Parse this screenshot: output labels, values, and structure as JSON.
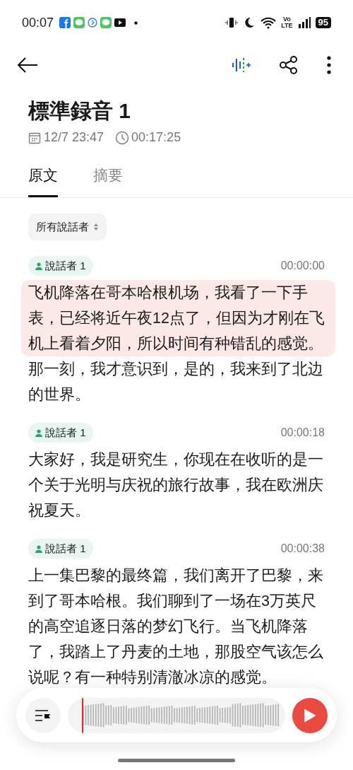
{
  "status_bar": {
    "time": "00:07",
    "network": [
      "Vo",
      "LTE"
    ],
    "battery": "95"
  },
  "recording": {
    "title": "標準録音 1",
    "date": "12/7 23:47",
    "duration": "00:17:25"
  },
  "tabs": [
    {
      "label": "原文",
      "selected": true
    },
    {
      "label": "摘要",
      "selected": false
    }
  ],
  "speaker_filter": {
    "label": "所有說話者"
  },
  "segments": [
    {
      "speaker": "說話者 1",
      "time": "00:00:00",
      "sentences": [
        {
          "text": "飞机降落在哥本哈根机场，我看了一下手表，已经将近午夜12点了，但因为才刚在飞机上看着夕阳，所以时间有种错乱的感觉。",
          "highlighted": true
        },
        {
          "text": "那一刻，我才意识到，是的，我来到了北边的世界。",
          "highlighted": false
        }
      ]
    },
    {
      "speaker": "說話者 1",
      "time": "00:00:18",
      "sentences": [
        {
          "text": "大家好，我是研究生，你现在在收听的是一个关于光明与庆祝的旅行故事，我在欧洲庆祝夏天。",
          "highlighted": false
        }
      ]
    },
    {
      "speaker": "說話者 1",
      "time": "00:00:38",
      "sentences": [
        {
          "text": "上一集巴黎的最终篇，我们离开了巴黎，来到了哥本哈根。我们聊到了一场在3万英尺的高空追逐日落的梦幻飞行。当飞机降落了，我踏上了丹麦的土地，那股空气该怎么说呢？有一种特别清澈冰凉的感觉。",
          "highlighted": false
        }
      ]
    }
  ]
}
